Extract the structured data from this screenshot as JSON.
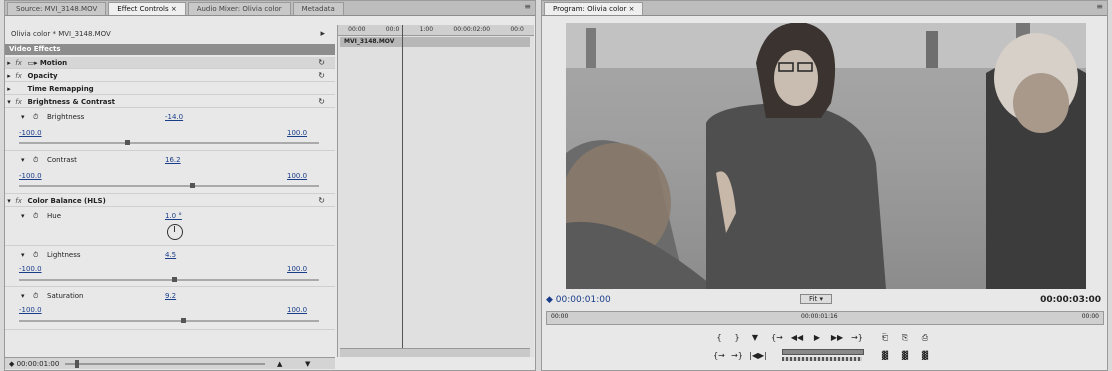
{
  "left_panel": {
    "tabs": [
      {
        "label": "Source: MVI_3148.MOV"
      },
      {
        "label": "Effect Controls ×"
      },
      {
        "label": "Audio Mixer: Olivia color"
      },
      {
        "label": "Metadata"
      }
    ],
    "menu_label": "≡",
    "clip_header": "Olivia color * MVI_3148.MOV",
    "section_title": "Video Effects",
    "timeline": {
      "ruler_labels": [
        "00:00",
        "00:0",
        "1:00",
        "00:00:02:00",
        "00:0"
      ],
      "clip_label": "MVI_3148.MOV"
    },
    "effects": [
      {
        "name": "Motion",
        "prefix": "▭▸"
      },
      {
        "name": "Opacity"
      },
      {
        "name": "Time Remapping"
      },
      {
        "name": "Brightness & Contrast"
      }
    ],
    "brightness": {
      "label": "Brightness",
      "value": "-14.0",
      "min": "-100.0",
      "max": "100.0",
      "level": 0.36
    },
    "contrast": {
      "label": "Contrast",
      "value": "16.2",
      "min": "-100.0",
      "max": "100.0",
      "level": 0.58
    },
    "color_balance": {
      "name": "Color Balance (HLS)"
    },
    "hue": {
      "label": "Hue",
      "value": "1.0 °"
    },
    "lightness": {
      "label": "Lightness",
      "value": "4.5",
      "min": "-100.0",
      "max": "100.0",
      "level": 0.52
    },
    "saturation": {
      "label": "Saturation",
      "value": "9.2",
      "min": "-100.0",
      "max": "100.0",
      "level": 0.55
    },
    "footer_timecode": "◆ 00:00:01:00"
  },
  "right_panel": {
    "tab": "Program: Olivia color ×",
    "menu_label": "≡",
    "timecode_current": "◆ 00:00:01:00",
    "fit_label": "Fit",
    "timecode_duration": "00:00:03:00",
    "mini_timeline_labels": [
      "00:00",
      "00:00:01:16",
      "00:00"
    ],
    "controls_row1": [
      "{",
      "}",
      "▼",
      "{→",
      "◀◀",
      "▶",
      "▶▶",
      "→}",
      "⎗",
      "⎘",
      "⎙"
    ],
    "controls_row2": [
      "{→",
      "→}",
      "|◀▶|",
      "▓",
      "▓",
      "▓"
    ]
  }
}
